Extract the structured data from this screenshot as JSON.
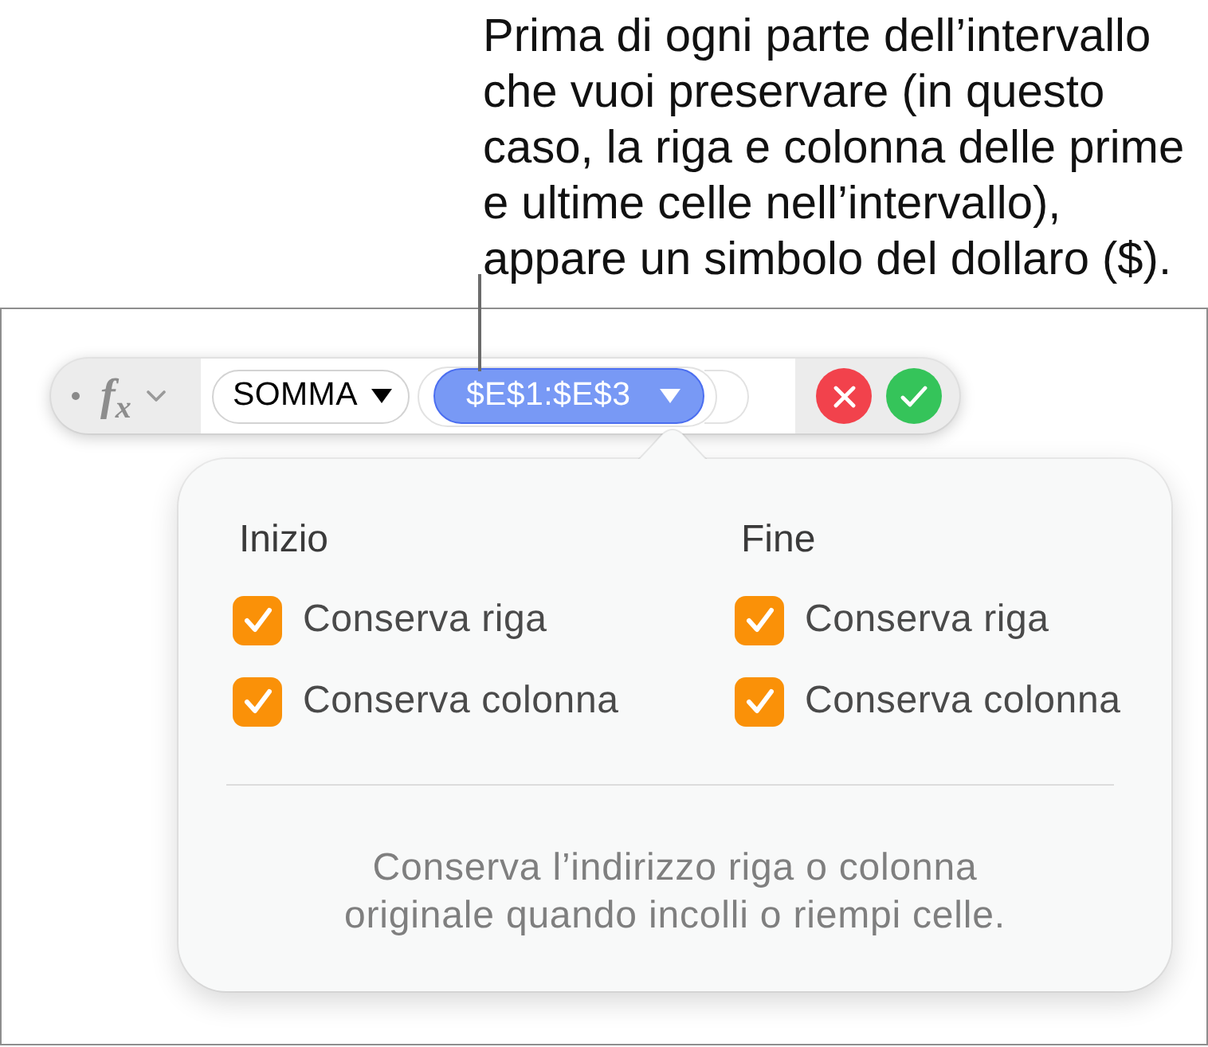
{
  "callout": {
    "lines": [
      "Prima di ogni parte dell’intervallo",
      "che vuoi preservare (in questo",
      "caso, la riga e colonna delle prime",
      "e ultime celle nell’intervallo),",
      "appare un simbolo del dollaro ($)."
    ]
  },
  "formula_bar": {
    "function_label": "f$_{x}$",
    "tokens": [
      {
        "kind": "function",
        "label": "SOMMA",
        "selected": false
      },
      {
        "kind": "reference",
        "label": "$E$1:$E$3",
        "selected": true
      }
    ]
  },
  "popover": {
    "sections": [
      {
        "title": "Inizio",
        "options": [
          {
            "label": "Conserva riga",
            "checked": true
          },
          {
            "label": "Conserva colonna",
            "checked": true
          }
        ]
      },
      {
        "title": "Fine",
        "options": [
          {
            "label": "Conserva riga",
            "checked": true
          },
          {
            "label": "Conserva colonna",
            "checked": true
          }
        ]
      }
    ],
    "note_lines": [
      "Conserva l’indirizzo riga o colonna",
      "originale quando incolli o riempi celle."
    ]
  }
}
